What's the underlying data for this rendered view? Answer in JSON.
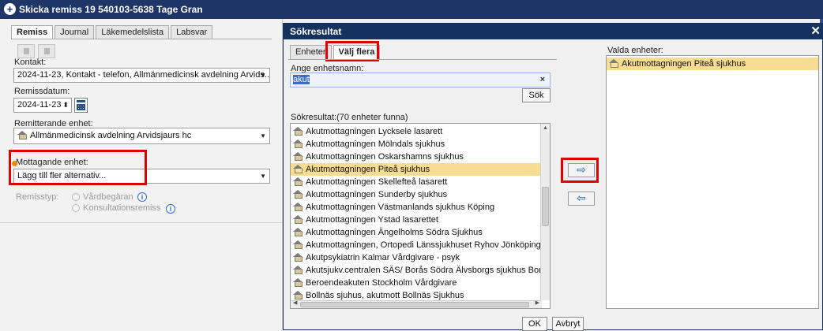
{
  "main_window": {
    "title": "Skicka remiss 19 540103-5638 Tage Gran",
    "tabs": [
      {
        "label": "Remiss",
        "active": true
      },
      {
        "label": "Journal",
        "active": false
      },
      {
        "label": "Läkemedelslista",
        "active": false
      },
      {
        "label": "Labsvar",
        "active": false
      }
    ],
    "kontakt_label": "Kontakt:",
    "kontakt_value": "2024-11-23, Kontakt - telefon, Allmänmedicinsk avdelning Arvids...",
    "remissdatum_label": "Remissdatum:",
    "remissdatum_value": "2024-11-23",
    "remitterande_label": "Remitterande enhet:",
    "remitterande_value": "Allmänmedicinsk avdelning Arvidsjaurs hc",
    "mottagande_label": "Mottagande enhet:",
    "mottagande_value": "Lägg till fler alternativ...",
    "remisstyp_label": "Remisstyp:",
    "remisstyp_options": [
      "Vårdbegäran",
      "Konsultationsremiss"
    ]
  },
  "dialog": {
    "title": "Sökresultat",
    "close_icon": "✕",
    "tabs": [
      {
        "label": "Enheter",
        "active": false
      },
      {
        "label": "Välj flera",
        "active": true
      }
    ],
    "search_label": "Ange enhetsnamn:",
    "search_value": "akut",
    "clear_icon": "×",
    "search_button": "Sök",
    "results_label": "Sökresultat:(70 enheter funna)",
    "results": [
      "Akutmottagningen Lycksele lasarett",
      "Akutmottagningen Mölndals sjukhus",
      "Akutmottagningen Oskarshamns sjukhus",
      "Akutmottagningen Piteå sjukhus",
      "Akutmottagningen Skellefteå lasarett",
      "Akutmottagningen Sunderby sjukhus",
      "Akutmottagningen Västmanlands sjukhus Köping",
      "Akutmottagningen Ystad lasarettet",
      "Akutmottagningen Ängelholms Södra Sjukhus",
      "Akutmottagningen, Ortopedi Länssjukhuset Ryhov Jönköping",
      "Akutpsykiatrin Kalmar Vårdgivare - psyk",
      "Akutsjukv.centralen SÄS/ Borås Södra Älvsborgs sjukhus Borås",
      "Beroendeakuten Stockholm Vårdgivare",
      "Bollnäs sjuhus, akutmott Bollnäs Sjukhus"
    ],
    "selected_result_index": 3,
    "valda_label": "Valda enheter:",
    "valda": [
      "Akutmottagningen Piteå sjukhus"
    ],
    "ok_button": "OK",
    "cancel_button": "Avbryt"
  },
  "colors": {
    "titlebar": "#1d3567",
    "highlight_box": "#e00000",
    "selection": "#f7dc93"
  }
}
